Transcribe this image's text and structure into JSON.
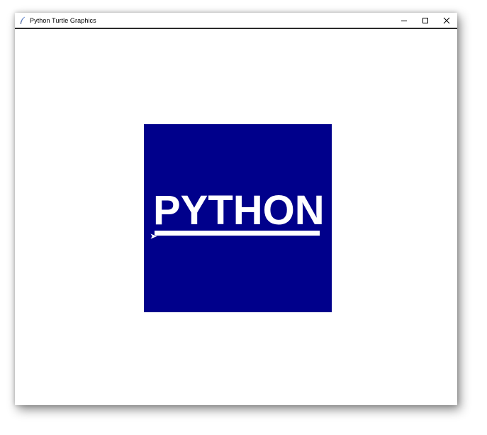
{
  "window": {
    "title": "Python Turtle Graphics",
    "app_icon": "feather-icon",
    "controls": [
      "minimize-icon",
      "maximize-icon",
      "close-icon"
    ]
  },
  "canvas": {
    "background": "#ffffff",
    "square_color": "#00008b",
    "text": "PYTHON",
    "text_color": "#ffffff",
    "cursor_icon": "turtle-arrow-icon"
  }
}
